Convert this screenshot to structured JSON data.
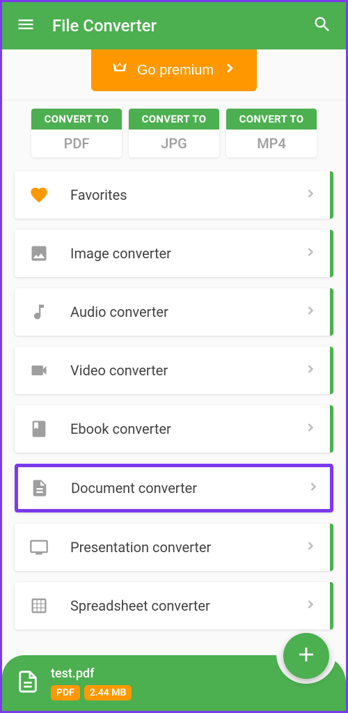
{
  "header": {
    "title": "File Converter"
  },
  "premium": {
    "label": "Go premium"
  },
  "convert": {
    "top_label": "CONVERT TO",
    "items": [
      {
        "format": "PDF"
      },
      {
        "format": "JPG"
      },
      {
        "format": "MP4"
      }
    ]
  },
  "menu": [
    {
      "label": "Favorites",
      "icon": "heart",
      "highlighted": false
    },
    {
      "label": "Image converter",
      "icon": "image",
      "highlighted": false
    },
    {
      "label": "Audio converter",
      "icon": "music",
      "highlighted": false
    },
    {
      "label": "Video converter",
      "icon": "video",
      "highlighted": false
    },
    {
      "label": "Ebook converter",
      "icon": "book",
      "highlighted": false
    },
    {
      "label": "Document converter",
      "icon": "document",
      "highlighted": true
    },
    {
      "label": "Presentation converter",
      "icon": "monitor",
      "highlighted": false
    },
    {
      "label": "Spreadsheet converter",
      "icon": "grid",
      "highlighted": false
    }
  ],
  "file": {
    "name": "test.pdf",
    "format_badge": "PDF",
    "size_badge": "2.44 MB"
  }
}
